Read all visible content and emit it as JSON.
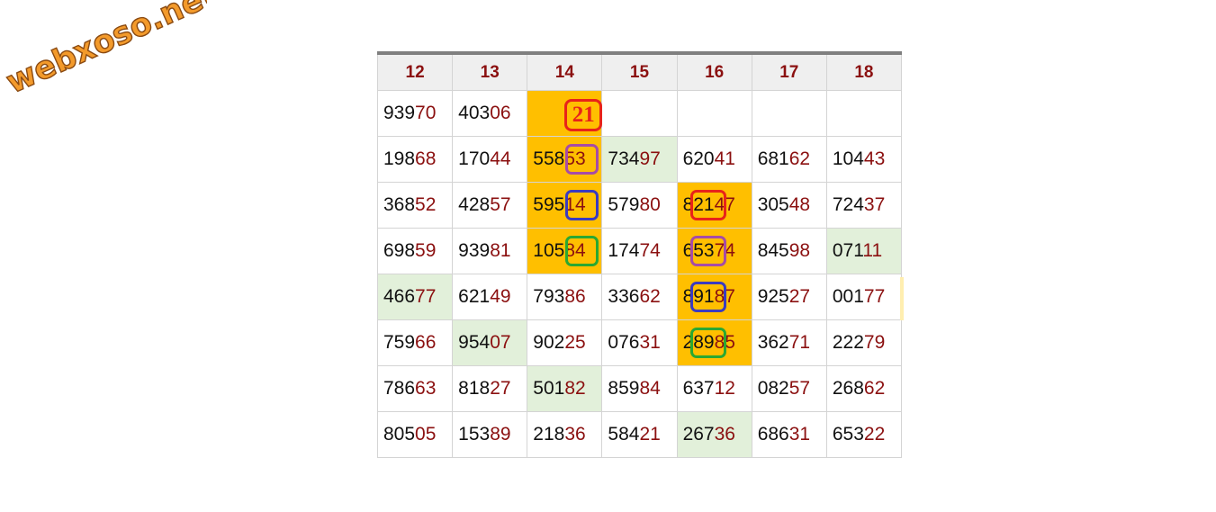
{
  "watermark": {
    "text": "webxoso.net"
  },
  "colors": {
    "header_text": "#8b1010",
    "highlight": "#ffbf00",
    "light_green": "#e2f0da",
    "mark_red": "#e8231a",
    "mark_purple": "#a64ca6",
    "mark_blue": "#3b3bbf",
    "mark_green": "#2aa832"
  },
  "grid": {
    "columns": [
      "12",
      "13",
      "14",
      "15",
      "16",
      "17",
      "18"
    ],
    "rows": [
      [
        {
          "head": "939",
          "tail": "70"
        },
        {
          "head": "403",
          "tail": "06"
        },
        {
          "head": "",
          "tail": "",
          "hl": "orange",
          "big_mark": "21"
        },
        {
          "head": "",
          "tail": ""
        },
        {
          "head": "",
          "tail": ""
        },
        {
          "head": "",
          "tail": ""
        },
        {
          "head": "",
          "tail": ""
        }
      ],
      [
        {
          "head": "198",
          "tail": "68"
        },
        {
          "head": "170",
          "tail": "44"
        },
        {
          "head": "558",
          "tail": "53",
          "hl": "orange",
          "mark": "purple"
        },
        {
          "head": "734",
          "tail": "97",
          "hl": "green"
        },
        {
          "head": "620",
          "tail": "41"
        },
        {
          "head": "681",
          "tail": "62"
        },
        {
          "head": "104",
          "tail": "43"
        }
      ],
      [
        {
          "head": "368",
          "tail": "52"
        },
        {
          "head": "428",
          "tail": "57"
        },
        {
          "head": "595",
          "tail": "14",
          "hl": "orange",
          "mark": "blue"
        },
        {
          "head": "579",
          "tail": "80"
        },
        {
          "head": "821",
          "tail": "47",
          "hl": "orange",
          "mark": "red"
        },
        {
          "head": "305",
          "tail": "48"
        },
        {
          "head": "724",
          "tail": "37"
        }
      ],
      [
        {
          "head": "698",
          "tail": "59"
        },
        {
          "head": "939",
          "tail": "81"
        },
        {
          "head": "105",
          "tail": "84",
          "hl": "orange",
          "mark": "green"
        },
        {
          "head": "174",
          "tail": "74"
        },
        {
          "head": "653",
          "tail": "74",
          "hl": "orange",
          "mark": "purple"
        },
        {
          "head": "845",
          "tail": "98"
        },
        {
          "head": "071",
          "tail": "11",
          "hl": "green"
        }
      ],
      [
        {
          "head": "466",
          "tail": "77",
          "hl": "green"
        },
        {
          "head": "621",
          "tail": "49"
        },
        {
          "head": "793",
          "tail": "86"
        },
        {
          "head": "336",
          "tail": "62"
        },
        {
          "head": "891",
          "tail": "87",
          "hl": "orange",
          "mark": "blue"
        },
        {
          "head": "925",
          "tail": "27"
        },
        {
          "head": "001",
          "tail": "77"
        }
      ],
      [
        {
          "head": "759",
          "tail": "66"
        },
        {
          "head": "954",
          "tail": "07",
          "hl": "green"
        },
        {
          "head": "902",
          "tail": "25"
        },
        {
          "head": "076",
          "tail": "31"
        },
        {
          "head": "289",
          "tail": "85",
          "hl": "orange",
          "mark": "green"
        },
        {
          "head": "362",
          "tail": "71"
        },
        {
          "head": "222",
          "tail": "79"
        }
      ],
      [
        {
          "head": "786",
          "tail": "63"
        },
        {
          "head": "818",
          "tail": "27"
        },
        {
          "head": "501",
          "tail": "82",
          "hl": "green"
        },
        {
          "head": "859",
          "tail": "84"
        },
        {
          "head": "637",
          "tail": "12"
        },
        {
          "head": "082",
          "tail": "57"
        },
        {
          "head": "268",
          "tail": "62"
        }
      ],
      [
        {
          "head": "805",
          "tail": "05"
        },
        {
          "head": "153",
          "tail": "89"
        },
        {
          "head": "218",
          "tail": "36"
        },
        {
          "head": "584",
          "tail": "21"
        },
        {
          "head": "267",
          "tail": "36",
          "hl": "green"
        },
        {
          "head": "686",
          "tail": "31"
        },
        {
          "head": "653",
          "tail": "22"
        }
      ]
    ]
  }
}
